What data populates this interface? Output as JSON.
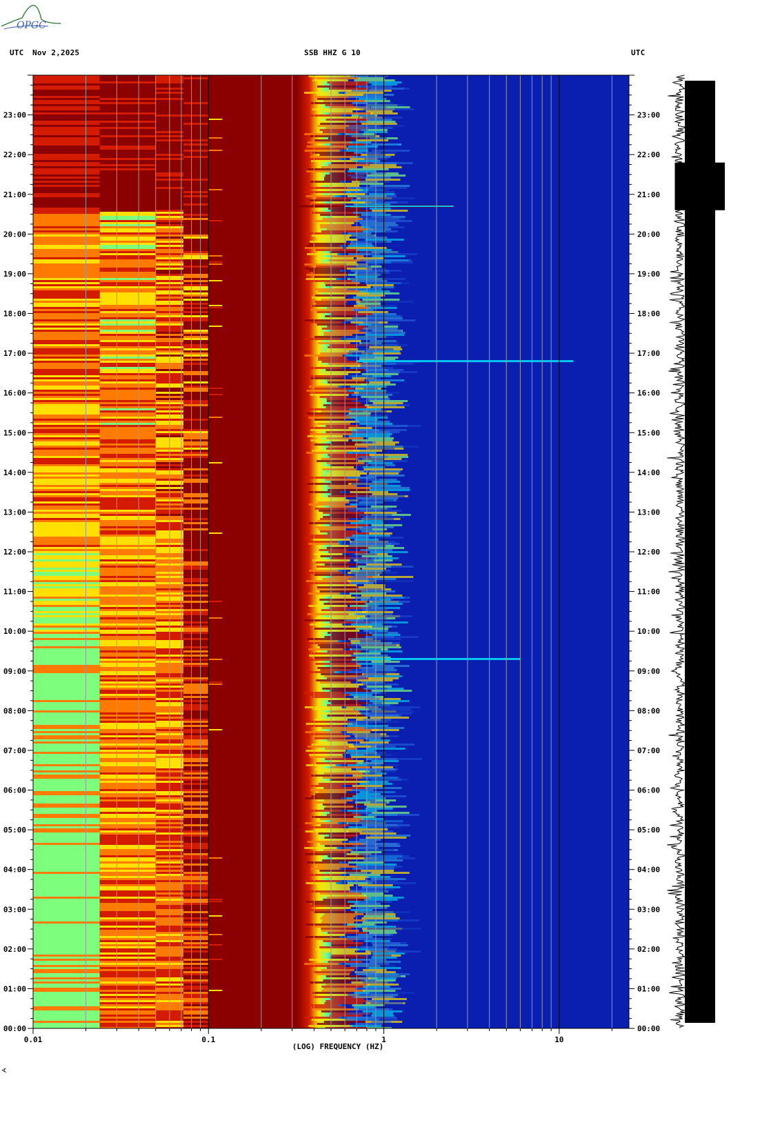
{
  "header": {
    "left_tz": "UTC",
    "date": "Nov 2,2025",
    "station": "SSB HHZ G 10",
    "right_tz": "UTC"
  },
  "logo": {
    "text": "OPGC"
  },
  "footer": {
    "mark": "∢"
  },
  "colors": {
    "low": "#00008b",
    "blue": "#0a1fb0",
    "cyan": "#00c8f0",
    "green": "#7dff7d",
    "yellow": "#ffe000",
    "orange": "#ff7a00",
    "red": "#d41b00",
    "darkred": "#8b0000",
    "trace": "#000000"
  },
  "chart_data": {
    "type": "heatmap",
    "title": "SSB HHZ G 10",
    "xlabel": "(LOG) FREQUENCY (HZ)",
    "ylabel": "",
    "x_scale": "log",
    "xlim": [
      0.01,
      25
    ],
    "x_ticks": [
      {
        "value": 0.01,
        "label": "0.01"
      },
      {
        "value": 0.1,
        "label": "0.1"
      },
      {
        "value": 1,
        "label": "1"
      },
      {
        "value": 10,
        "label": "10"
      }
    ],
    "y_ticks_left": [
      "00:00",
      "01:00",
      "02:00",
      "03:00",
      "04:00",
      "05:00",
      "06:00",
      "07:00",
      "08:00",
      "09:00",
      "10:00",
      "11:00",
      "12:00",
      "13:00",
      "14:00",
      "15:00",
      "16:00",
      "17:00",
      "18:00",
      "19:00",
      "20:00",
      "21:00",
      "22:00",
      "23:00"
    ],
    "y_ticks_right": [
      "00:00",
      "01:00",
      "02:00",
      "03:00",
      "04:00",
      "05:00",
      "06:00",
      "07:00",
      "08:00",
      "09:00",
      "10:00",
      "11:00",
      "12:00",
      "13:00",
      "14:00",
      "15:00",
      "16:00",
      "17:00",
      "18:00",
      "19:00",
      "20:00",
      "21:00",
      "22:00",
      "23:00"
    ],
    "ylim_hours": [
      0,
      24
    ],
    "gridlines_hz": [
      0.02,
      0.03,
      0.04,
      0.05,
      0.06,
      0.07,
      0.08,
      0.09,
      0.2,
      0.3,
      0.4,
      0.5,
      0.6,
      0.7,
      0.8,
      0.9,
      2,
      3,
      4,
      5,
      6,
      7,
      8,
      9,
      20
    ],
    "bands_hz": [
      {
        "from": 0.01,
        "to": 0.024,
        "level": "mixed-yellow-green",
        "top_level": "red"
      },
      {
        "from": 0.024,
        "to": 0.05,
        "level": "mixed-orange-yellow",
        "top_level": "red"
      },
      {
        "from": 0.05,
        "to": 0.072,
        "level": "mixed-orange",
        "top_level": "red"
      },
      {
        "from": 0.072,
        "to": 0.1,
        "level": "mixed-red-orange",
        "top_level": "red"
      },
      {
        "from": 0.1,
        "to": 0.32,
        "level": "darkred"
      },
      {
        "from": 0.32,
        "to": 0.6,
        "level": "gradient-red-to-cyan"
      },
      {
        "from": 0.6,
        "to": 25,
        "level": "blue"
      }
    ],
    "events": [
      {
        "time_h": 20.7,
        "f_from_hz": 0.3,
        "f_to_hz": 2.5,
        "label": ""
      },
      {
        "time_h": 16.8,
        "f_from_hz": 0.7,
        "f_to_hz": 12,
        "label": ""
      },
      {
        "time_h": 9.3,
        "f_from_hz": 0.7,
        "f_to_hz": 6,
        "label": ""
      }
    ],
    "seismogram": {
      "saturated_hours": [
        20.6,
        21.8
      ]
    }
  }
}
